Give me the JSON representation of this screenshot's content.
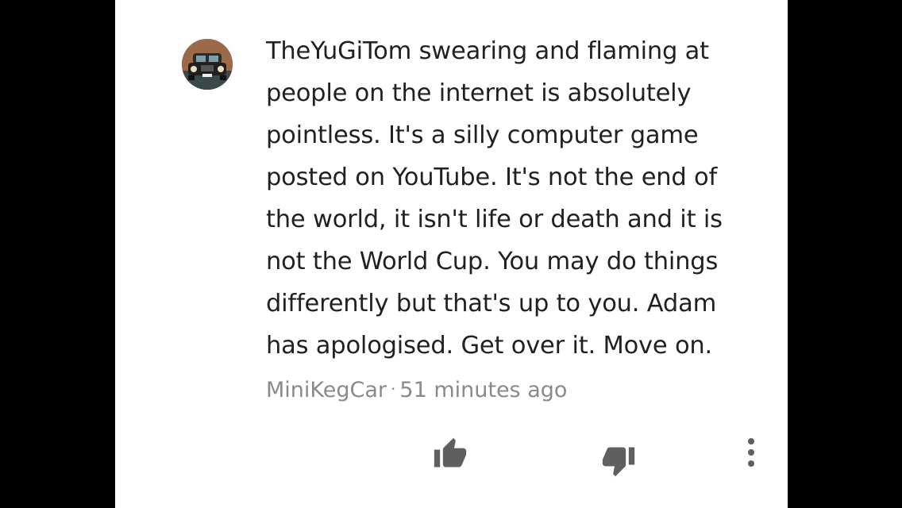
{
  "comment": {
    "text_lines": [
      "TheYuGiTom swearing and flaming at",
      "people on the internet is absolutely",
      "pointless. It's a silly computer game",
      "posted on YouTube. It's not the end of",
      "the world, it isn't life or death and it is",
      "not the World Cup. You may do things",
      "differently but that's up to you. Adam",
      "has apologised. Get over it. Move on."
    ],
    "author": "MiniKegCar",
    "separator": "·",
    "time": "51 minutes ago",
    "avatar_icon": "car-photo-avatar"
  },
  "actions": {
    "like_icon": "thumbs-up-icon",
    "dislike_icon": "thumbs-down-icon",
    "more_icon": "more-vertical-icon"
  },
  "colors": {
    "text": "#212121",
    "meta": "#8a8a8a",
    "icon": "#5f5f5f",
    "background": "#ffffff",
    "letterbox": "#000000"
  }
}
